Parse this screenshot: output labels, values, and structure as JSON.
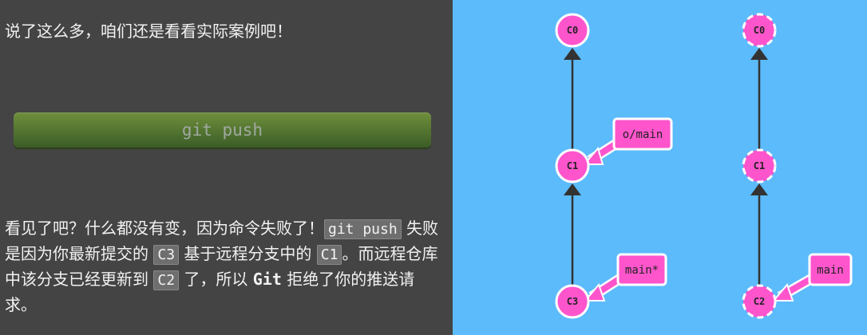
{
  "intro": "说了这么多，咱们还是看看实际案例吧！",
  "command_button": "git push",
  "explanation": {
    "p1": "看见了吧？什么都没有变，因为命令失败了！",
    "code_git_push": "git push",
    "p2": " 失败是因为你最新提交的 ",
    "code_c3": "C3",
    "p3": " 基于远程分支中的 ",
    "code_c1": "C1",
    "p4": "。而远程仓库中该分支已经更新到 ",
    "code_c2": "C2",
    "p5": " 了，所以 ",
    "git": "Git",
    "p6": " 拒绝了你的推送请求。"
  },
  "local_repo": {
    "commits": [
      "C0",
      "C1",
      "C3"
    ],
    "branches": [
      "o/main",
      "main*"
    ]
  },
  "remote_repo": {
    "commits": [
      "C0",
      "C1",
      "C2"
    ],
    "branches": [
      "main"
    ]
  },
  "colors": {
    "commit_fill": "#ff55cc",
    "branch_fill": "#ff55cc",
    "background": "#5cbbfb"
  }
}
